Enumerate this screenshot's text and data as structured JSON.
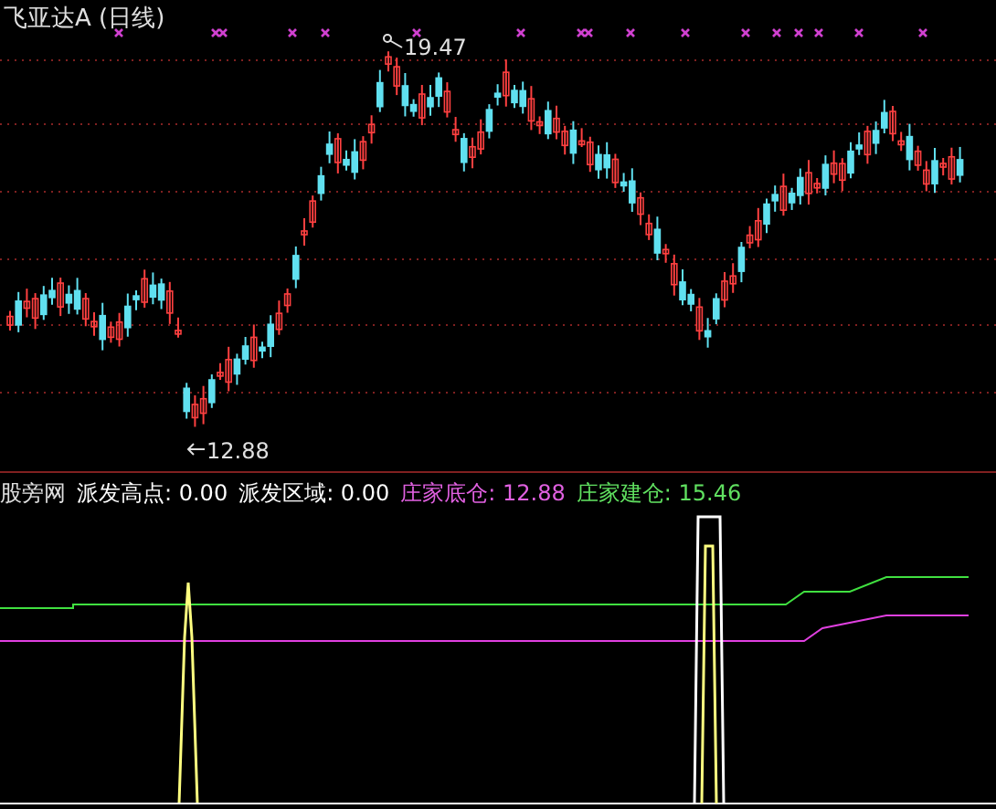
{
  "main_chart": {
    "title": "飞亚达A (日线)",
    "high_label": "19.47",
    "low_label": "12.88"
  },
  "indicator": {
    "name": "股旁网",
    "items": [
      {
        "text": "派发高点: 0.00",
        "color": "#ffffff"
      },
      {
        "text": "派发区域: 0.00",
        "color": "#ffffff"
      },
      {
        "text": "庄家底仓: 12.88",
        "color": "#e060e0"
      },
      {
        "text": "庄家建仓: 15.46",
        "color": "#60e060"
      }
    ]
  }
}
